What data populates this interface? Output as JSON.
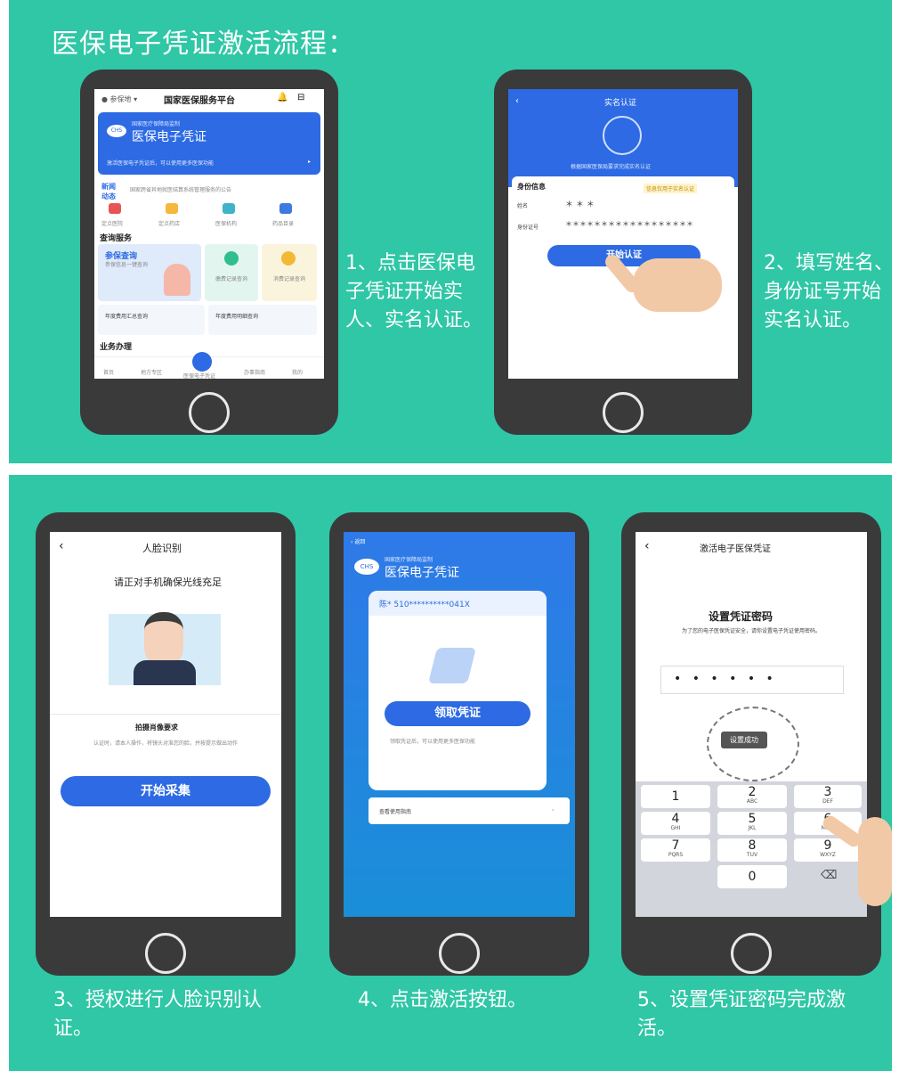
{
  "title": "医保电子凭证激活流程：",
  "steps": {
    "s1": "1、点击医保电子凭证开始实人、实名认证。",
    "s2": "2、填写姓名、身份证号开始实名认证。",
    "s3": "3、授权进行人脸识别认证。",
    "s4": "4、点击激活按钮。",
    "s5": "5、设置凭证密码完成激活。"
  },
  "phone1": {
    "location": "参保地",
    "app_title": "国家医保服务平台",
    "banner_small": "国家医疗保障局监制",
    "banner_title": "医保电子凭证",
    "banner_tip": "激活医保电子凭证后，可以使用更多医保功能",
    "news_label": "新闻动态",
    "news_text": "国家跨省异地就医结算系统管理服务的公告",
    "shortcuts": [
      "定点医院",
      "定点药店",
      "医保机构",
      "药品目录"
    ],
    "query_header": "查询服务",
    "query_card": "参保查询",
    "query_sub": "参保信息一键查询",
    "tile_a": "缴费记录查询",
    "tile_b": "消费记录查询",
    "tile_c": "年度费用汇总查询",
    "tile_d": "年度费用明细查询",
    "biz_header": "业务办理",
    "tabs": [
      "首页",
      "地方专区",
      "医保电子凭证",
      "办事指南",
      "我的"
    ]
  },
  "phone2": {
    "header": "实名认证",
    "notice": "根据国家医保局要求完成实名认证",
    "section": "身份信息",
    "tag": "信息仅用于实名认证",
    "name_label": "姓名",
    "name_value": "＊ ＊ ＊",
    "id_label": "身份证号",
    "id_value": "＊＊＊＊＊＊＊＊＊＊＊＊＊＊＊＊＊＊",
    "button": "开始认证"
  },
  "phone3": {
    "header": "人脸识别",
    "instruction": "请正对手机确保光线充足",
    "req_title": "拍摄肖像要求",
    "req_text": "认证时，请本人操作，将镜头对准您的脸，并按提示做出动作",
    "button": "开始采集"
  },
  "phone4": {
    "back": "返回",
    "banner_small": "国家医疗保障局监制",
    "banner_title": "医保电子凭证",
    "holder": "陈* 510**********041X",
    "button": "领取凭证",
    "tip": "领取凭证后，可以使用更多医保功能",
    "guide": "查看使用指南"
  },
  "phone5": {
    "header": "激活电子医保凭证",
    "pwd_title": "设置凭证密码",
    "pwd_desc": "为了您的电子医保凭证安全，请你设置电子凭证使用密码。",
    "dots": "•  •  •  •  •  •",
    "success": "设置成功",
    "keys": [
      {
        "n": "1",
        "s": ""
      },
      {
        "n": "2",
        "s": "ABC"
      },
      {
        "n": "3",
        "s": "DEF"
      },
      {
        "n": "4",
        "s": "GHI"
      },
      {
        "n": "5",
        "s": "JKL"
      },
      {
        "n": "6",
        "s": "MNO"
      },
      {
        "n": "7",
        "s": "PQRS"
      },
      {
        "n": "8",
        "s": "TUV"
      },
      {
        "n": "9",
        "s": "WXYZ"
      },
      {
        "n": "0",
        "s": ""
      }
    ],
    "backspace": "⌫"
  },
  "colors": {
    "panel": "#2fc7a6",
    "brand_blue": "#2d6ae3",
    "phone_body": "#3a3a3a"
  }
}
